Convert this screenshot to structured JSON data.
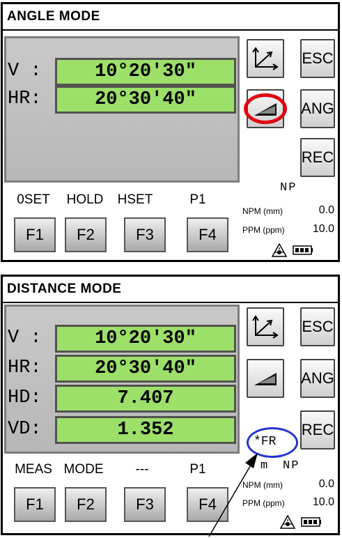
{
  "angle_mode": {
    "title": "ANGLE MODE",
    "rows": [
      {
        "label": "V :",
        "value": "10°20'30\""
      },
      {
        "label": "HR:",
        "value": "20°30'40\""
      }
    ],
    "side_buttons": {
      "esc": "ESC",
      "ang": "ANG",
      "rec": "REC"
    },
    "softkeys": [
      "0SET",
      "HOLD",
      "HSET",
      "P1"
    ],
    "fkeys": [
      "F1",
      "F2",
      "F3",
      "F4"
    ],
    "status": {
      "np": "NP",
      "npm_label": "NPM (mm)",
      "npm_value": "0.0",
      "ppm_label": "PPM (ppm)",
      "ppm_value": "10.0"
    }
  },
  "distance_mode": {
    "title": "DISTANCE MODE",
    "rows": [
      {
        "label": "V :",
        "value": "10°20'30\""
      },
      {
        "label": "HR:",
        "value": "20°30'40\""
      },
      {
        "label": "HD:",
        "value": "7.407"
      },
      {
        "label": "VD:",
        "value": "1.352"
      }
    ],
    "side_buttons": {
      "esc": "ESC",
      "ang": "ANG",
      "rec": "REC"
    },
    "fr_indicator": "*FR",
    "unit": "m",
    "softkeys": [
      "MEAS",
      "MODE",
      "---",
      "P1"
    ],
    "fkeys": [
      "F1",
      "F2",
      "F3",
      "F4"
    ],
    "status": {
      "np": "NP",
      "npm_label": "NPM (mm)",
      "npm_value": "0.0",
      "ppm_label": "PPM (ppm)",
      "ppm_value": "10.0"
    }
  },
  "icons": [
    "axes-icon",
    "slope-icon",
    "laser-icon",
    "battery-icon"
  ],
  "colors": {
    "display_green": "#9ce06a",
    "highlight_red": "#e0000f",
    "highlight_blue": "#2233d4"
  }
}
